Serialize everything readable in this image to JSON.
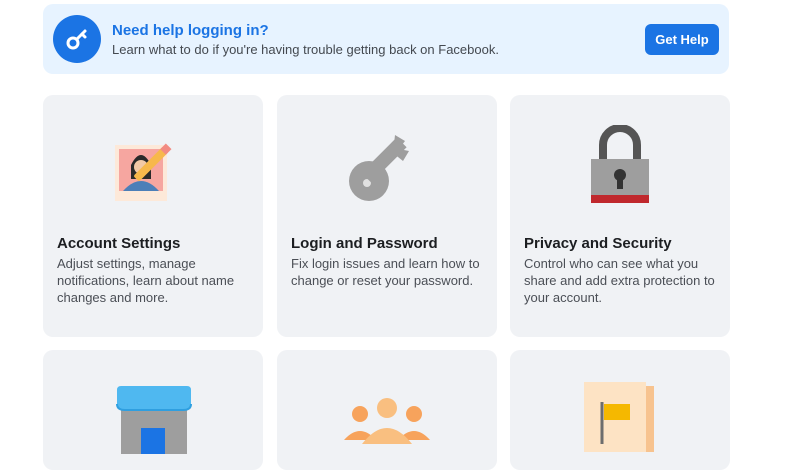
{
  "banner": {
    "title": "Need help logging in?",
    "subtitle": "Learn what to do if you're having trouble getting back on Facebook.",
    "button_label": "Get Help",
    "icon": "key-icon"
  },
  "cards": [
    {
      "title": "Account Settings",
      "description": "Adjust settings, manage notifications, learn about name changes and more.",
      "icon": "profile-photo-pencil-icon"
    },
    {
      "title": "Login and Password",
      "description": "Fix login issues and learn how to change or reset your password.",
      "icon": "key-icon"
    },
    {
      "title": "Privacy and Security",
      "description": "Control who can see what you share and add extra protection to your account.",
      "icon": "padlock-icon"
    },
    {
      "icon": "storefront-icon"
    },
    {
      "icon": "group-people-icon"
    },
    {
      "icon": "flag-document-icon"
    }
  ],
  "colors": {
    "accent": "#1b74e4",
    "banner_bg": "#e7f3ff",
    "card_bg": "#f0f2f5"
  }
}
